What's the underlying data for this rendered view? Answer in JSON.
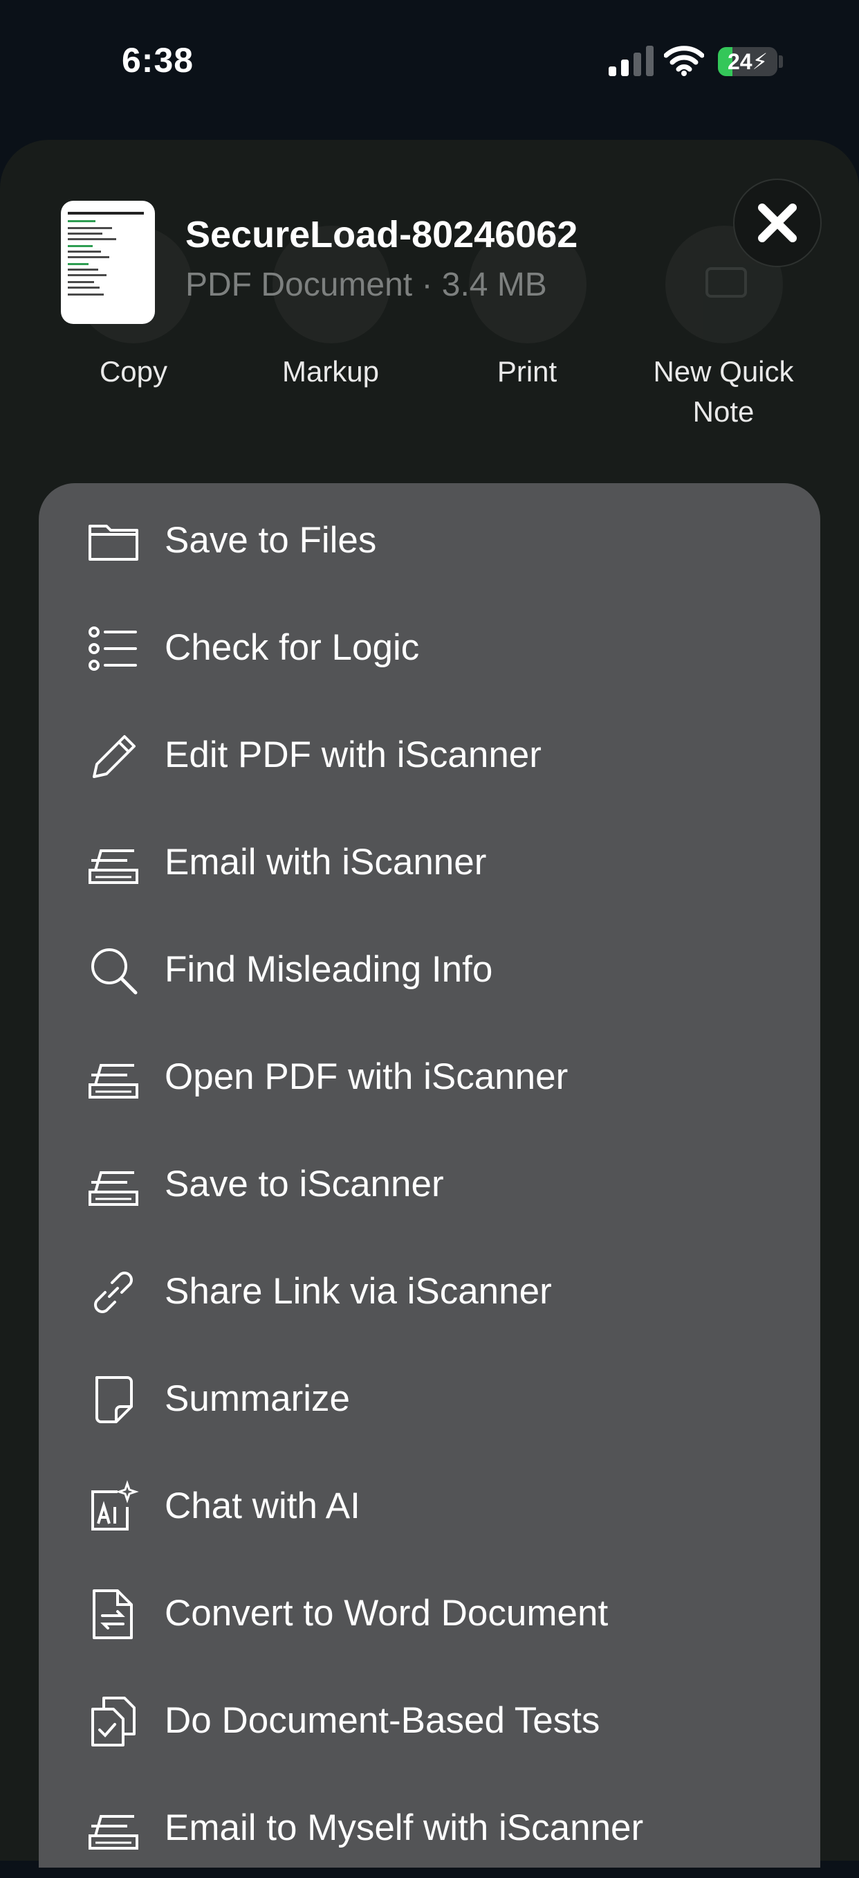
{
  "status": {
    "time": "6:38",
    "battery": "24",
    "battery_level": 0.24
  },
  "file": {
    "name": "SecureLoad-80246062",
    "meta": "PDF Document · 3.4 MB"
  },
  "actions": [
    {
      "label": "Copy",
      "icon": "copy-icon"
    },
    {
      "label": "Markup",
      "icon": "markup-icon"
    },
    {
      "label": "Print",
      "icon": "print-icon"
    },
    {
      "label": "New Quick Note",
      "icon": "quick-note-icon"
    }
  ],
  "menu": [
    {
      "label": "Save to Files",
      "icon": "folder-icon"
    },
    {
      "label": "Check for Logic",
      "icon": "list-icon"
    },
    {
      "label": "Edit PDF with iScanner",
      "icon": "pencil-icon"
    },
    {
      "label": "Email with iScanner",
      "icon": "scanner-icon"
    },
    {
      "label": "Find Misleading Info",
      "icon": "search-icon"
    },
    {
      "label": "Open PDF with iScanner",
      "icon": "scanner-icon"
    },
    {
      "label": "Save to iScanner",
      "icon": "scanner-icon"
    },
    {
      "label": "Share Link via iScanner",
      "icon": "link-icon"
    },
    {
      "label": "Summarize",
      "icon": "note-icon"
    },
    {
      "label": "Chat with AI",
      "icon": "ai-icon"
    },
    {
      "label": "Convert to Word Document",
      "icon": "convert-document-icon"
    },
    {
      "label": "Do Document-Based Tests",
      "icon": "document-check-icon"
    },
    {
      "label": "Email to Myself with iScanner",
      "icon": "scanner-icon"
    }
  ]
}
